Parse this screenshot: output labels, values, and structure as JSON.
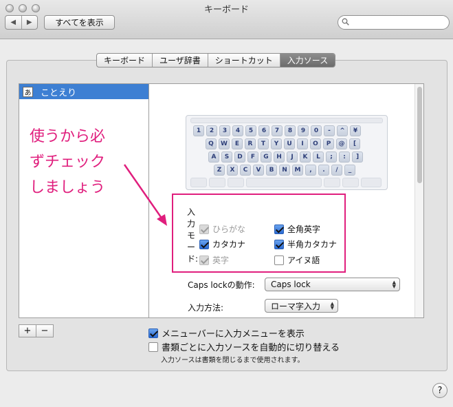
{
  "window": {
    "title": "キーボード"
  },
  "toolbar": {
    "back": "◀",
    "forward": "▶",
    "show_all": "すべてを表示",
    "search_placeholder": ""
  },
  "tabs": [
    {
      "label": "キーボード",
      "active": false
    },
    {
      "label": "ユーザ辞書",
      "active": false
    },
    {
      "label": "ショートカット",
      "active": false
    },
    {
      "label": "入力ソース",
      "active": true
    }
  ],
  "source_list": {
    "items": [
      {
        "icon_char": "あ",
        "label": "ことえり",
        "selected": true
      }
    ]
  },
  "keyboard": {
    "rows": [
      [
        "1",
        "2",
        "3",
        "4",
        "5",
        "6",
        "7",
        "8",
        "9",
        "0",
        "-",
        "^",
        "¥"
      ],
      [
        "Q",
        "W",
        "E",
        "R",
        "T",
        "Y",
        "U",
        "I",
        "O",
        "P",
        "@",
        "["
      ],
      [
        "A",
        "S",
        "D",
        "F",
        "G",
        "H",
        "J",
        "K",
        "L",
        ";",
        ":",
        "]"
      ],
      [
        "Z",
        "X",
        "C",
        "V",
        "B",
        "N",
        "M",
        ",",
        ".",
        "/",
        "_"
      ]
    ]
  },
  "input_modes": {
    "label": "入力モード:",
    "items": [
      {
        "label": "ひらがな",
        "checked": true,
        "enabled": false
      },
      {
        "label": "全角英字",
        "checked": true,
        "enabled": true
      },
      {
        "label": "カタカナ",
        "checked": true,
        "enabled": true
      },
      {
        "label": "半角カタカナ",
        "checked": true,
        "enabled": true
      },
      {
        "label": "英字",
        "checked": true,
        "enabled": false
      },
      {
        "label": "アイヌ語",
        "checked": false,
        "enabled": true
      }
    ]
  },
  "caps_lock": {
    "label": "Caps lockの動作:",
    "value": "Caps lock"
  },
  "input_method": {
    "label": "入力方法:",
    "value": "ローマ字入力"
  },
  "list_buttons": {
    "add": "+",
    "remove": "−"
  },
  "options": {
    "show_menu": {
      "label": "メニューバーに入力メニューを表示",
      "checked": true
    },
    "auto_switch": {
      "label": "書類ごとに入力ソースを自動的に切り替える",
      "checked": false
    },
    "note": "入力ソースは書類を閉じるまで使用されます。"
  },
  "help": "?",
  "annotation": {
    "line1": "使うから必",
    "line2": "ずチェック",
    "line3": "しましょう",
    "color": "#e01e7d"
  },
  "colors": {
    "selection": "#3d7fd3",
    "checkbox_on": "#2a6ad3",
    "annotation": "#e01e7d"
  }
}
